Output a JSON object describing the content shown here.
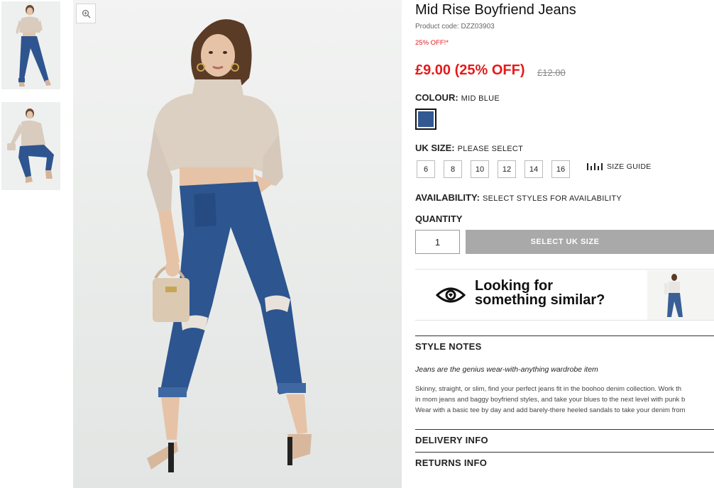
{
  "product": {
    "title": "Mid Rise Boyfriend Jeans",
    "code": "Product code: DZZ03903",
    "promo": "25% OFF!*",
    "price": "£9.00 (25% OFF)",
    "was_price": "£12.00"
  },
  "colour": {
    "label": "COLOUR:",
    "value": "MID BLUE",
    "swatch_color": "#345891"
  },
  "size": {
    "label": "UK SIZE:",
    "value": "PLEASE SELECT",
    "options": [
      "6",
      "8",
      "10",
      "12",
      "14",
      "16"
    ],
    "guide_label": "SIZE GUIDE"
  },
  "availability": {
    "label": "AVAILABILITY:",
    "value": "SELECT STYLES FOR AVAILABILITY"
  },
  "quantity": {
    "label": "QUANTITY",
    "value": "1"
  },
  "cta": {
    "label": "SELECT UK SIZE"
  },
  "similar": {
    "line1": "Looking for",
    "line2": "something similar?"
  },
  "style_notes": {
    "heading": "STYLE NOTES",
    "tagline": "Jeans are the genius wear-with-anything wardrobe item",
    "lines": [
      "Skinny, straight, or slim, find your perfect jeans fit in the boohoo denim collection. Work th",
      "in mom jeans and baggy boyfriend styles, and take your blues to the next level with punk b",
      "Wear with a basic tee by day and add barely-there heeled sandals to take your denim from"
    ]
  },
  "delivery": {
    "heading": "DELIVERY INFO"
  },
  "returns": {
    "heading": "RETURNS INFO"
  },
  "colors": {
    "sale_red": "#e51a1a",
    "cta_grey": "#a9a9a9",
    "denim": "#345891"
  }
}
